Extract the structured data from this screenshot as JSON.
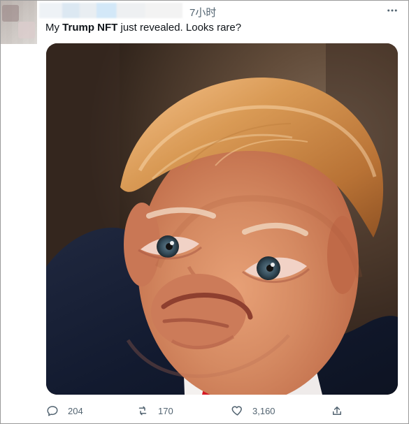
{
  "tweet": {
    "time": "7小时",
    "text_before": "My ",
    "text_strong": "Trump NFT",
    "text_after": " just revealed. Looks rare?"
  },
  "colors": {
    "meta": "#536471",
    "text": "#0f1419",
    "frame": "#9a9a9a"
  },
  "icons": {
    "more": "more-horizontal-icon",
    "reply": "reply-bubble-icon",
    "retweet": "retweet-arrows-icon",
    "like": "heart-icon",
    "share": "share-upload-icon"
  },
  "metrics": {
    "reply_count": "204",
    "retweet_count": "170",
    "like_count": "3,160"
  }
}
